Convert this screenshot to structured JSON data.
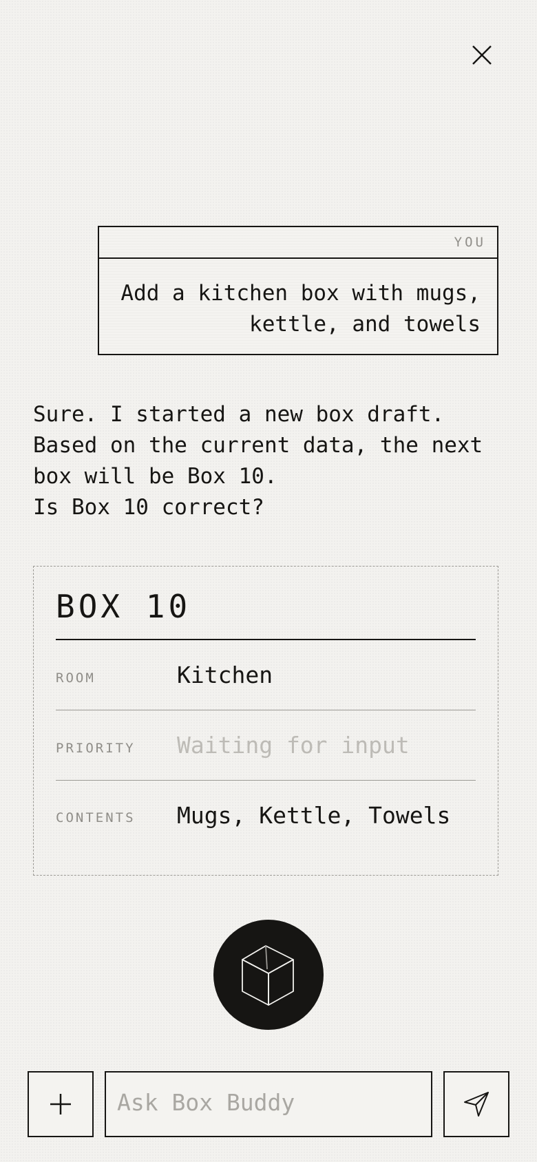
{
  "header": {
    "close_icon": "close-icon"
  },
  "conversation": {
    "user": {
      "sender": "YOU",
      "text": "Add a kitchen box with mugs, kettle, and towels"
    },
    "assistant": {
      "lines": [
        "Sure. I started a new box draft.",
        "Based on the current data, the next box will be Box 10.",
        "Is Box 10 correct?"
      ]
    }
  },
  "box_draft": {
    "title": "BOX 10",
    "fields": [
      {
        "label": "ROOM",
        "value": "Kitchen",
        "placeholder": ""
      },
      {
        "label": "PRIORITY",
        "value": "",
        "placeholder": "Waiting for input"
      },
      {
        "label": "CONTENTS",
        "value": "Mugs, Kettle, Towels",
        "placeholder": ""
      }
    ]
  },
  "assistant_button": {
    "icon": "box-cube-icon"
  },
  "composer": {
    "add_icon": "plus-icon",
    "placeholder": "Ask Box Buddy",
    "value": "",
    "send_icon": "send-icon"
  },
  "colors": {
    "background": "#f3f2ef",
    "ink": "#161513",
    "muted": "#8f8d88",
    "placeholder": "#bdbbb6"
  }
}
